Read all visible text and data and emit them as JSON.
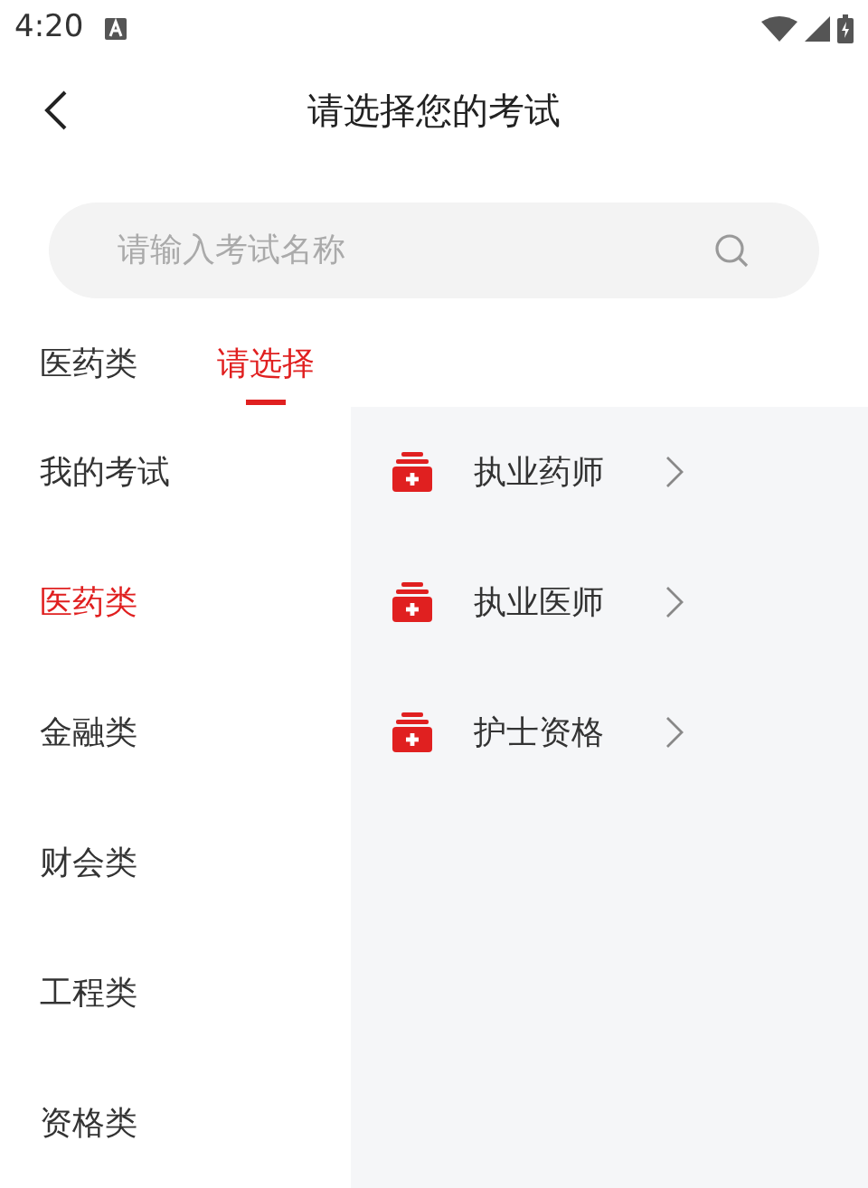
{
  "status_bar": {
    "time": "4:20"
  },
  "header": {
    "title": "请选择您的考试"
  },
  "search": {
    "placeholder": "请输入考试名称"
  },
  "tabs": [
    {
      "label": "医药类",
      "selected": false
    },
    {
      "label": "请选择",
      "selected": true
    }
  ],
  "sidebar": {
    "items": [
      {
        "label": "我的考试",
        "selected": false
      },
      {
        "label": "医药类",
        "selected": true
      },
      {
        "label": "金融类",
        "selected": false
      },
      {
        "label": "财会类",
        "selected": false
      },
      {
        "label": "工程类",
        "selected": false
      },
      {
        "label": "资格类",
        "selected": false
      }
    ]
  },
  "exams": [
    {
      "label": "执业药师"
    },
    {
      "label": "执业医师"
    },
    {
      "label": "护士资格"
    }
  ]
}
